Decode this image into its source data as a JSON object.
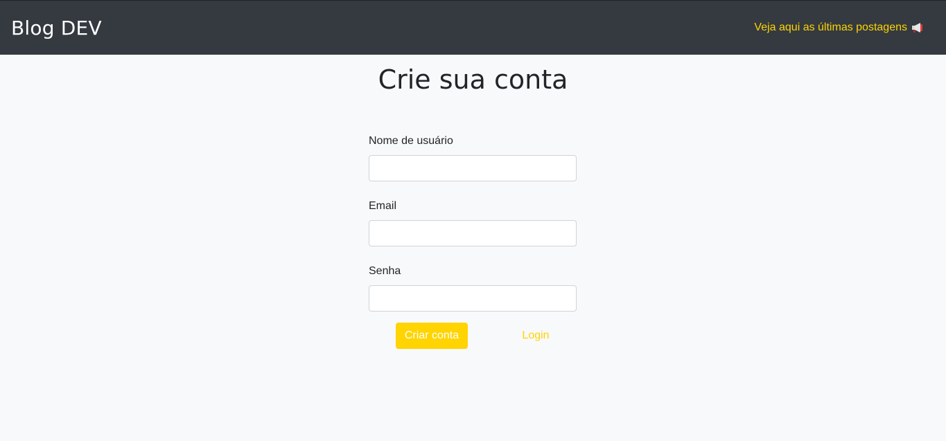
{
  "navbar": {
    "brand": "Blog DEV",
    "latest_posts_link": "Veja aqui as últimas postagens",
    "latest_posts_icon": "megaphone-icon"
  },
  "page": {
    "title": "Crie sua conta"
  },
  "form": {
    "username_label": "Nome de usuário",
    "username_value": "",
    "email_label": "Email",
    "email_value": "",
    "password_label": "Senha",
    "password_value": "",
    "submit_label": "Criar conta",
    "login_link": "Login"
  },
  "colors": {
    "navbar_bg": "#343a40",
    "accent": "#ffd400",
    "page_bg": "#f8f9fa"
  }
}
